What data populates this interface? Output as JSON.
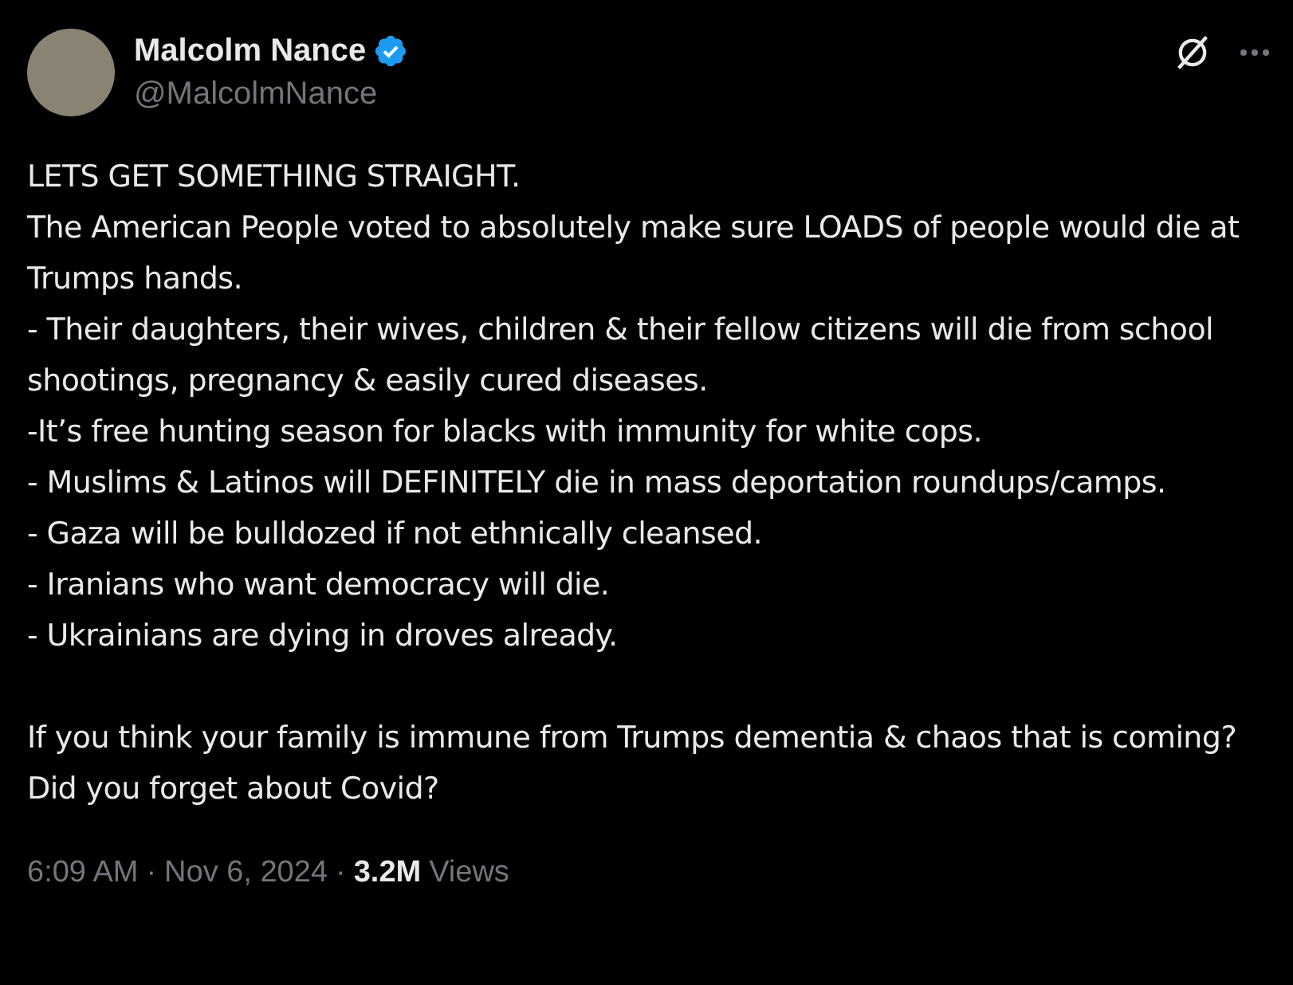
{
  "author": {
    "name": "Malcolm Nance",
    "verified": true,
    "handle": "@MalcolmNance"
  },
  "paragraphs": [
    [
      "LETS GET SOMETHING STRAIGHT.",
      "The American People voted to absolutely make sure LOADS of people would die at Trumps hands.",
      "- Their daughters, their wives, children & their fellow citizens will die from school shootings, pregnancy & easily cured diseases.",
      "-It’s free hunting season for blacks with immunity for white cops.",
      "- Muslims & Latinos will DEFINITELY die in mass deportation roundups/camps.",
      "- Gaza will be bulldozed if not ethnically cleansed.",
      "- Iranians who want democracy will die.",
      "- Ukrainians are dying in droves already."
    ],
    [
      "If you think your family is immune from Trumps dementia & chaos that is coming? Did you forget about Covid?"
    ]
  ],
  "footer": {
    "time": "6:09 AM",
    "separator_1": "·",
    "date": "Nov 6, 2024",
    "separator_2": "·",
    "views_count": "3.2M",
    "views_label": "Views"
  }
}
